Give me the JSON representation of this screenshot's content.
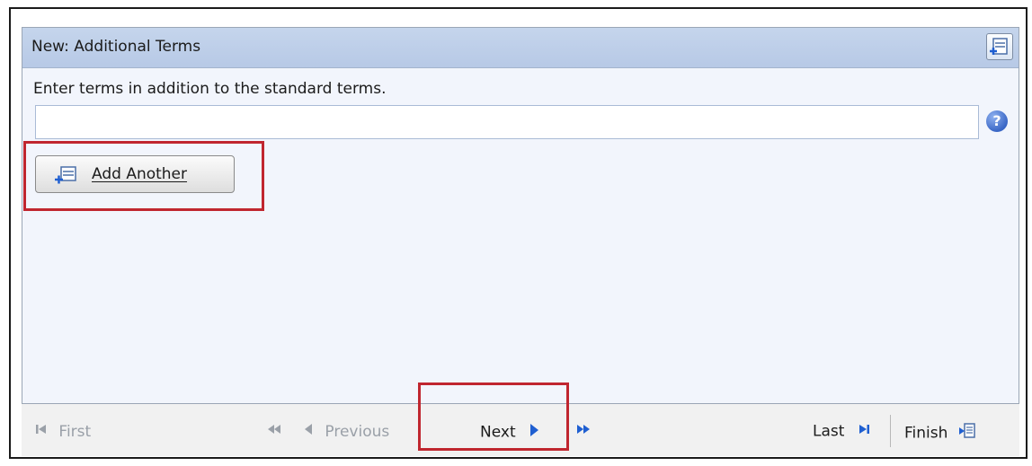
{
  "header": {
    "title": "New: Additional Terms"
  },
  "form": {
    "instructions": "Enter terms in addition to the standard terms.",
    "term_value": "",
    "help_glyph": "?"
  },
  "buttons": {
    "add_another": "Add Another"
  },
  "nav": {
    "first": "First",
    "previous": "Previous",
    "next": "Next",
    "last": "Last",
    "finish": "Finish"
  },
  "colors": {
    "header_bg": "#c5d5ec",
    "panel_bg": "#f2f5fc",
    "highlight": "#c0262f",
    "nav_arrow": "#1f5fd1"
  },
  "icons": {
    "header": "add-row-icon",
    "add_button": "add-row-icon",
    "help": "help-icon",
    "first": "first-page-icon",
    "rewind": "rewind-icon",
    "previous": "previous-arrow-icon",
    "next": "next-arrow-icon",
    "fast_forward": "fast-forward-icon",
    "last": "last-page-icon",
    "finish": "finish-icon"
  }
}
